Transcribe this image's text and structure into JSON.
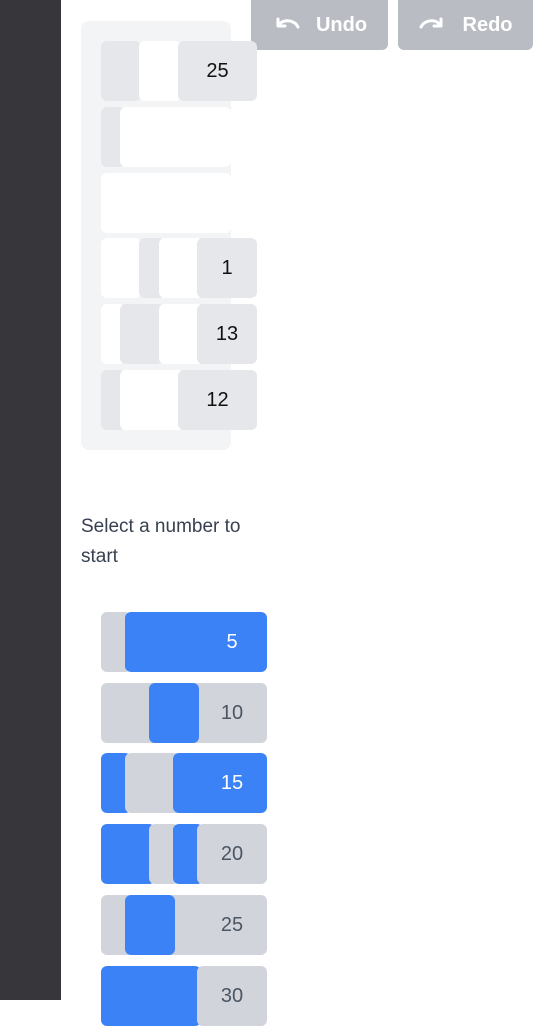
{
  "toolbar": {
    "undo_label": "Undo",
    "redo_label": "Redo",
    "undo_icon": "undo-arrow-icon",
    "redo_icon": "redo-arrow-icon"
  },
  "board": {
    "rows": [
      {
        "number": "25"
      },
      {
        "number": ""
      },
      {
        "number": ""
      },
      {
        "number": "1"
      },
      {
        "number": "13"
      },
      {
        "number": "12"
      }
    ]
  },
  "prompt": "Select a number to start",
  "choices": [
    {
      "label": "5"
    },
    {
      "label": "10"
    },
    {
      "label": "15"
    },
    {
      "label": "20"
    },
    {
      "label": "25"
    },
    {
      "label": "30"
    }
  ],
  "colors": {
    "sidebar": "#37373b",
    "accent_blue": "#3b82f6",
    "tile_gray": "#e5e7eb",
    "choice_gray": "#d1d5db",
    "button_gray": "#b9bcc3"
  }
}
